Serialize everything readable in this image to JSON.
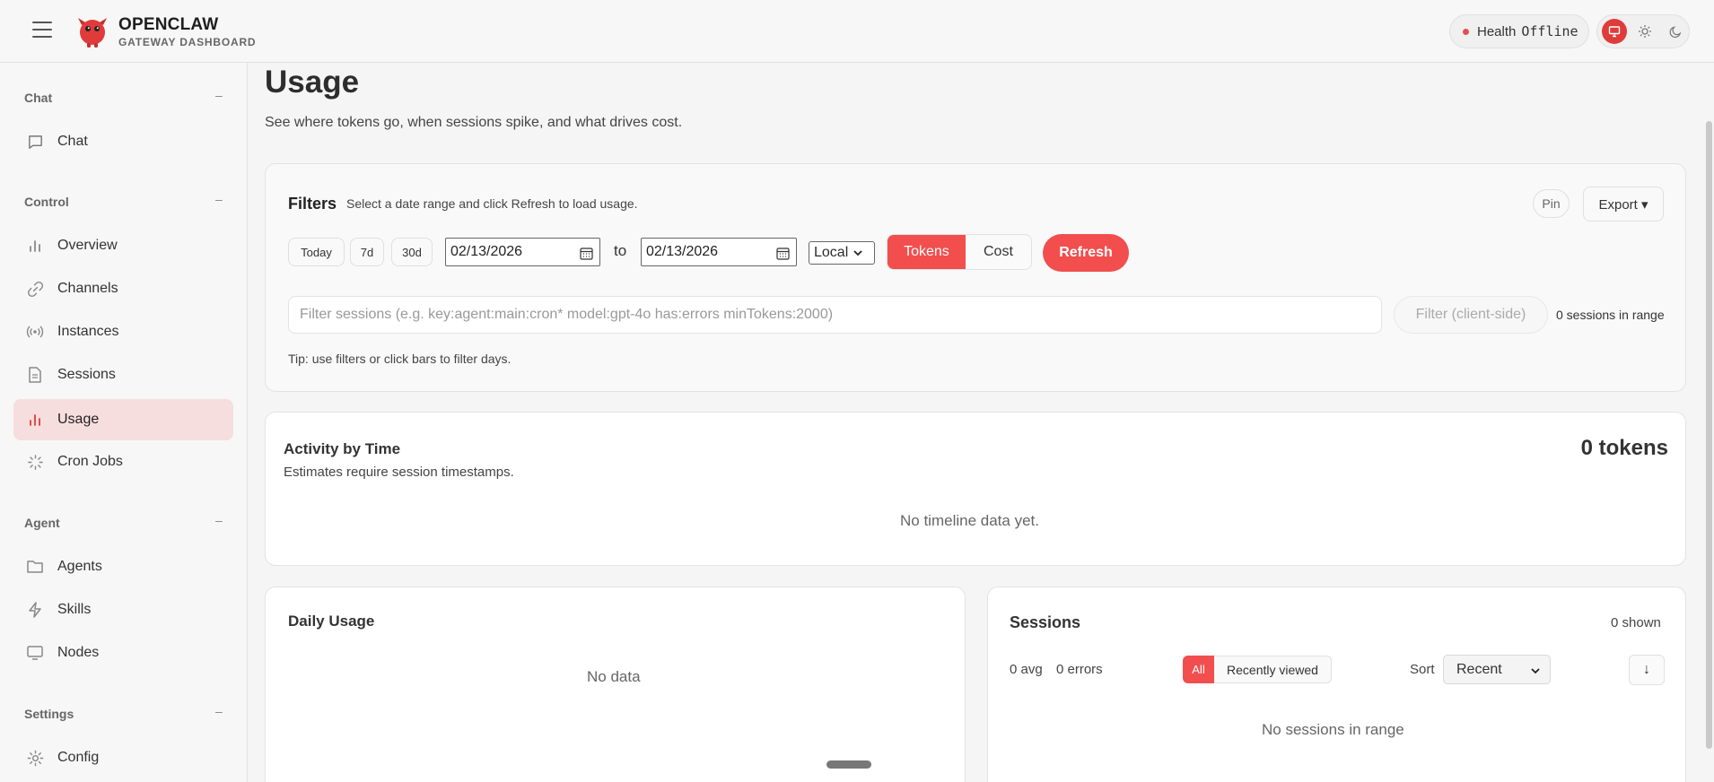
{
  "header": {
    "brand_title": "OPENCLAW",
    "brand_subtitle": "GATEWAY DASHBOARD",
    "health_label": "Health",
    "health_status": "Offline",
    "accent_color": "#f24e4e"
  },
  "sidebar": {
    "sections": [
      {
        "title": "Chat",
        "collapse": "–"
      },
      {
        "title": "Control",
        "collapse": "–"
      },
      {
        "title": "Agent",
        "collapse": "–"
      },
      {
        "title": "Settings",
        "collapse": "–"
      }
    ],
    "items": [
      {
        "label": "Chat",
        "icon": "chat-bubble-icon"
      },
      {
        "label": "Overview",
        "icon": "bar-chart-icon"
      },
      {
        "label": "Channels",
        "icon": "link-icon"
      },
      {
        "label": "Instances",
        "icon": "broadcast-icon"
      },
      {
        "label": "Sessions",
        "icon": "document-icon"
      },
      {
        "label": "Usage",
        "icon": "bar-chart-icon",
        "active": true
      },
      {
        "label": "Cron Jobs",
        "icon": "loader-icon"
      },
      {
        "label": "Agents",
        "icon": "folder-icon"
      },
      {
        "label": "Skills",
        "icon": "lightning-icon"
      },
      {
        "label": "Nodes",
        "icon": "monitor-icon"
      },
      {
        "label": "Config",
        "icon": "gear-icon"
      }
    ]
  },
  "page": {
    "title": "Usage",
    "subtitle": "See where tokens go, when sessions spike, and what drives cost."
  },
  "filters": {
    "title": "Filters",
    "hint": "Select a date range and click Refresh to load usage.",
    "pin_label": "Pin",
    "export_label": "Export ▾",
    "presets": [
      "Today",
      "7d",
      "30d"
    ],
    "start_date": "02/13/2026",
    "to_label": "to",
    "end_date": "02/13/2026",
    "timezone": "Local",
    "mode_tokens": "Tokens",
    "mode_cost": "Cost",
    "refresh_label": "Refresh",
    "search_placeholder": "Filter sessions (e.g. key:agent:main:cron* model:gpt-4o has:errors minTokens:2000)",
    "client_filter_label": "Filter (client-side)",
    "sessions_in_range": "0 sessions in range",
    "tip": "Tip: use filters or click bars to filter days."
  },
  "activity": {
    "title": "Activity by Time",
    "subtitle": "Estimates require session timestamps.",
    "total": "0 tokens",
    "empty": "No timeline data yet."
  },
  "daily": {
    "title": "Daily Usage",
    "empty": "No data"
  },
  "sessions": {
    "title": "Sessions",
    "shown": "0 shown",
    "avg": "0 avg",
    "errors": "0 errors",
    "tab_all": "All",
    "tab_recent": "Recently viewed",
    "sort_label": "Sort",
    "sort_value": "Recent",
    "sort_dir": "↓",
    "empty": "No sessions in range"
  }
}
